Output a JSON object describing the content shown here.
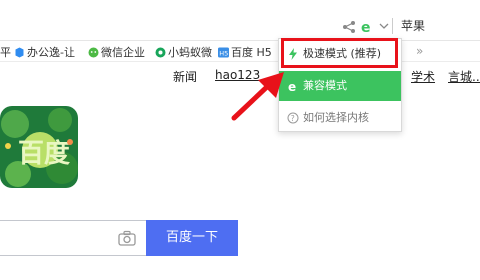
{
  "toolbar": {
    "menu_label": "苹果"
  },
  "bookmarks": [
    {
      "label": "平",
      "icon": "bookmark-icon"
    },
    {
      "label": "办公逸-让",
      "icon": "office-icon"
    },
    {
      "label": "微信企业",
      "icon": "wechat-icon"
    },
    {
      "label": "小蚂蚁微",
      "icon": "ant-icon"
    },
    {
      "label": "百度 H5",
      "icon": "h5-icon"
    }
  ],
  "bookmarks_more": "»",
  "baidu_nav": [
    {
      "label": "新闻"
    },
    {
      "label": "hao123"
    },
    {
      "label": "学术"
    },
    {
      "label": "言城..."
    }
  ],
  "engine_menu": {
    "items": [
      {
        "label": "极速模式 (推荐)",
        "icon": "lightning-icon"
      },
      {
        "label": "兼容模式",
        "icon": "ie-icon"
      },
      {
        "label": "如何选择内核",
        "icon": "help-icon"
      }
    ]
  },
  "search": {
    "button_label": "百度一下",
    "input_value": ""
  },
  "colors": {
    "compat_highlight": "#3cc35f",
    "annotation_red": "#e8121a",
    "search_button": "#4e6ef2"
  }
}
